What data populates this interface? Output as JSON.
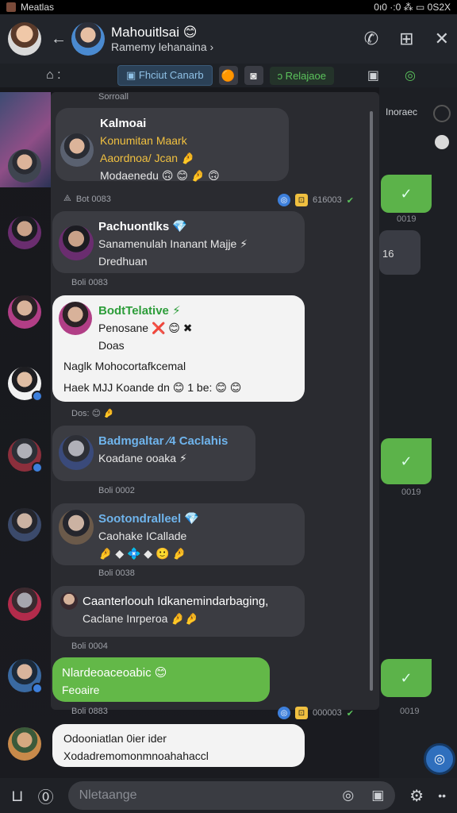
{
  "status_bar": {
    "left_text": "Meatlas",
    "right_text": "0ı0 ·:0 ⁂ ▭ 0S2X"
  },
  "header": {
    "title": "Mahouitlsai 😊",
    "subtitle": "Ramemy lehanaina ›",
    "back_icon": "←"
  },
  "toolbar": {
    "pill_label": "Fhciut Canarb",
    "green_label": "ͻ Relajaoe"
  },
  "messages": [
    {
      "name": "Kalmoai",
      "lines": [
        "Konumitan Maark",
        "Aaordnoa/ Jcan 🤌",
        "Modaenedu 🙃 😊 🤌 🙃"
      ],
      "time": "Bot 0083",
      "header_text": "Sorroall"
    },
    {
      "name": "Pachuontlks 💎",
      "lines": [
        "Sanamenulah Inanant Majje ⚡",
        "Dredhuan"
      ],
      "time": "Boli 0083"
    },
    {
      "name": "BodtTelative ⚡",
      "lines": [
        "Penosane ❌ 😊 ✖",
        "Doas",
        "Naglk Mohocortafkcemal",
        "Haek MJJ Koande dn 😊 1 be: 😊 😊"
      ],
      "time": "Dos: 😊 🤌"
    },
    {
      "name": "Badmgaltar ⁄4 Caclahis",
      "lines": [
        "Koadane ooaka ⚡"
      ],
      "time": "Boli 0002"
    },
    {
      "name": "Sootondralleel 💎",
      "lines": [
        "Caohake ICallade",
        "🤌 ◆ 💠 ◆ 🙂 🤌"
      ],
      "time": "Boli 0038"
    },
    {
      "name": "Caanterloouh Idkanemindarbaging,",
      "lines": [
        "Caclane Inrperoa 🤌🤌"
      ],
      "time": "Boli 0004"
    },
    {
      "name": "Nlardeoaceoabic 😊",
      "lines": [
        "Feoaire"
      ],
      "time": "Boli 0883"
    },
    {
      "name": "Odooniatlan 0ier ider",
      "lines": [
        "Xodadremomonmnoahahaccl"
      ]
    }
  ],
  "meta_mid": {
    "count": "616003"
  },
  "meta_bottom": {
    "count": "000003"
  },
  "right_column": {
    "top_label": "Inoraec",
    "meta1": "0019",
    "meta2": "16",
    "meta3": "0019",
    "meta4": "0019"
  },
  "input": {
    "placeholder": "Nletaange"
  }
}
